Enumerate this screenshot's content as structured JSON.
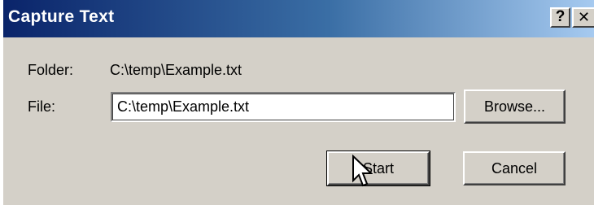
{
  "window": {
    "title": "Capture Text",
    "help_glyph": "?",
    "close_glyph": "✕"
  },
  "form": {
    "folder_label": "Folder:",
    "folder_value": "C:\\temp\\Example.txt",
    "file_label": "File:",
    "file_value": "C:\\temp\\Example.txt"
  },
  "buttons": {
    "browse": "Browse...",
    "start": "Start",
    "cancel": "Cancel"
  },
  "icons": {
    "cursor": "mouse-pointer-icon"
  },
  "colors": {
    "titlebar_start": "#0a246a",
    "titlebar_end": "#a6caf0",
    "dialog_face": "#d4d0c8"
  }
}
